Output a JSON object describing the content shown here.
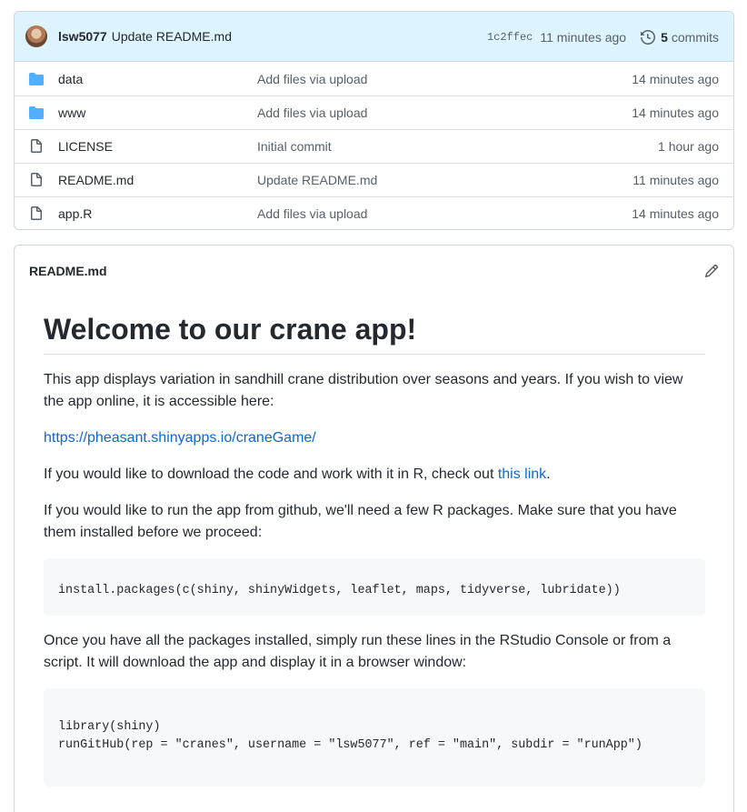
{
  "commit": {
    "author": "lsw5077",
    "message": "Update README.md",
    "sha": "1c2ffec",
    "time": "11 minutes ago",
    "count": "5",
    "count_label": "commits"
  },
  "files": [
    {
      "name": "data",
      "type": "folder",
      "message": "Add files via upload",
      "age": "14 minutes ago"
    },
    {
      "name": "www",
      "type": "folder",
      "message": "Add files via upload",
      "age": "14 minutes ago"
    },
    {
      "name": "LICENSE",
      "type": "file",
      "message": "Initial commit",
      "age": "1 hour ago"
    },
    {
      "name": "README.md",
      "type": "file",
      "message": "Update README.md",
      "age": "11 minutes ago"
    },
    {
      "name": "app.R",
      "type": "file",
      "message": "Add files via upload",
      "age": "14 minutes ago"
    }
  ],
  "readme": {
    "title": "README.md",
    "heading": "Welcome to our crane app!",
    "p1": "This app displays variation in sandhill crane distribution over seasons and years. If you wish to view the app online, it is accessible here:",
    "app_link": "https://pheasant.shinyapps.io/craneGame/",
    "p2_prefix": "If you would like to download the code and work with it in R, check out ",
    "p2_link": "this link",
    "p2_suffix": ".",
    "p3": "If you would like to run the app from github, we'll need a few R packages. Make sure that you have them installed before we proceed:",
    "code1": "install.packages(c(shiny, shinyWidgets, leaflet, maps, tidyverse, lubridate))",
    "p4": "Once you have all the packages installed, simply run these lines in the RStudio Console or from a script. It will download the app and display it in a browser window:",
    "code2_line1": "library(shiny)",
    "code2_line2": "runGitHub(rep = \"cranes\", username = \"lsw5077\", ref = \"main\", subdir = \"runApp\")"
  },
  "colors": {
    "folder": "#54aeff",
    "file_icon": "#57606a",
    "link": "#0969da",
    "commit_bar": "#ddf4ff"
  },
  "icons": {
    "folder": "folder-icon",
    "file": "file-icon",
    "history": "history-icon",
    "edit": "pencil-icon"
  }
}
